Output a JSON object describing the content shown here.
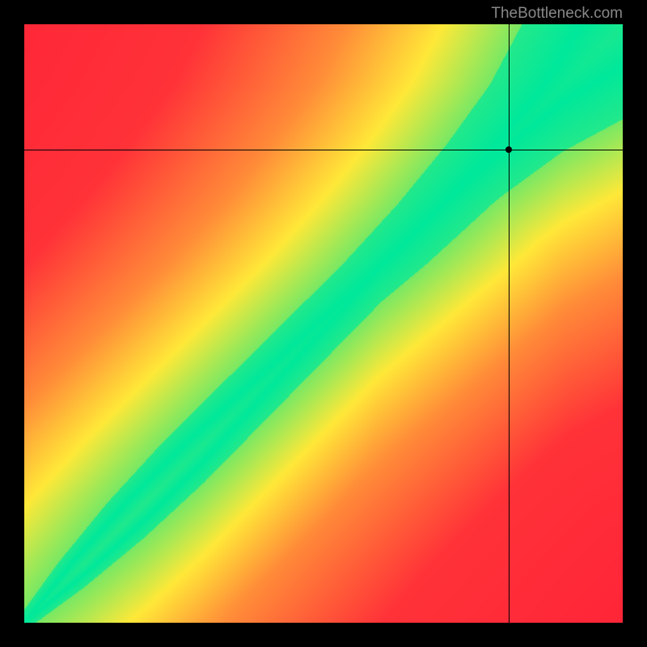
{
  "watermark": "TheBottleneck.com",
  "chart_data": {
    "type": "heatmap",
    "title": "",
    "xlabel": "",
    "ylabel": "",
    "xlim": [
      0,
      100
    ],
    "ylim": [
      0,
      100
    ],
    "crosshair": {
      "x": 81,
      "y": 79
    },
    "description": "Bottleneck performance heatmap. Green diagonal band indicates balanced configuration (optimal). Yellow indicates minor bottleneck. Red indicates severe bottleneck. The green band follows a slightly curved diagonal from bottom-left to top-right, suggesting an optimal balance line between two components (typically CPU vs GPU).",
    "color_scale": {
      "optimal": "#00E89B",
      "good": "#FFE838",
      "moderate": "#FFA838",
      "poor": "#FF5838",
      "severe": "#FF2838"
    },
    "optimal_band": {
      "type": "curve",
      "note": "Green band runs diagonally; distance from this band determines color (green→yellow→orange→red)",
      "sample_points": [
        {
          "x": 0,
          "y": 0
        },
        {
          "x": 10,
          "y": 8
        },
        {
          "x": 20,
          "y": 17
        },
        {
          "x": 30,
          "y": 27
        },
        {
          "x": 40,
          "y": 38
        },
        {
          "x": 50,
          "y": 49
        },
        {
          "x": 60,
          "y": 60
        },
        {
          "x": 70,
          "y": 70
        },
        {
          "x": 80,
          "y": 79
        },
        {
          "x": 90,
          "y": 87
        },
        {
          "x": 100,
          "y": 93
        }
      ]
    }
  }
}
